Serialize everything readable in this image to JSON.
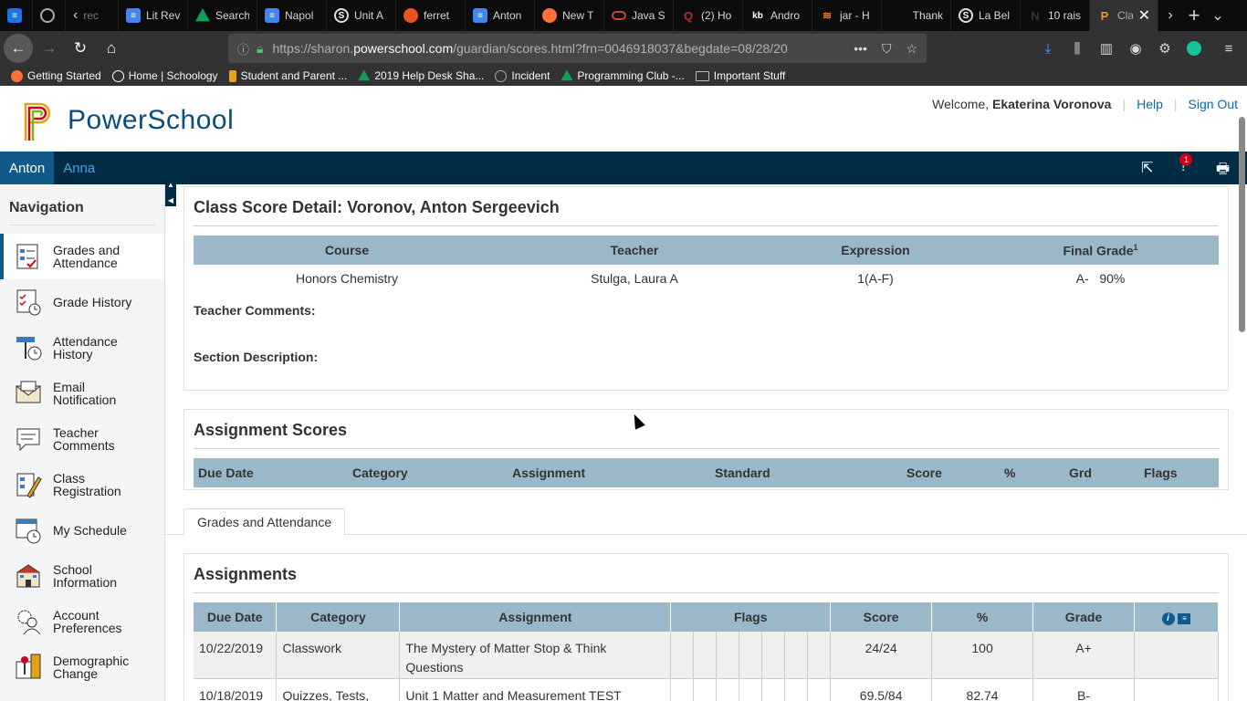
{
  "browser": {
    "tabs": [
      {
        "title": "",
        "color": "#1a73e8",
        "icon": "docs-icon"
      },
      {
        "title": "",
        "color": "#555",
        "icon": "circle-icon"
      },
      {
        "title": "rec",
        "color": "#0c0c0d",
        "icon": "chevron-left-icon"
      },
      {
        "title": "Lit Rev",
        "color": "#4285f4",
        "icon": "docs-icon"
      },
      {
        "title": "Search",
        "color": "#0f9d58",
        "icon": "drive-icon"
      },
      {
        "title": "Napol",
        "color": "#4285f4",
        "icon": "docs-icon"
      },
      {
        "title": "Unit A",
        "color": "#333",
        "icon": "schoology-icon"
      },
      {
        "title": "ferret",
        "color": "#e8541e",
        "icon": "duckduckgo-icon"
      },
      {
        "title": "Anton",
        "color": "#4285f4",
        "icon": "docs-icon"
      },
      {
        "title": "New T",
        "color": "#ff7139",
        "icon": "firefox-icon"
      },
      {
        "title": "Java S",
        "color": "#c74634",
        "icon": "oracle-icon"
      },
      {
        "title": "(2) Ho",
        "color": "#b92b27",
        "icon": "quora-icon"
      },
      {
        "title": "Andro",
        "color": "#222",
        "icon": "kb-icon"
      },
      {
        "title": "jar - H",
        "color": "#f48024",
        "icon": "stackoverflow-icon"
      },
      {
        "title": "Thank",
        "color": "#0c0c0d",
        "icon": "blank-icon"
      },
      {
        "title": "La Bel",
        "color": "#333",
        "icon": "schoology-icon"
      },
      {
        "title": "10 rais",
        "color": "#0c0c0d",
        "icon": "netflix-icon"
      },
      {
        "title": "Cla",
        "color": "#323234",
        "icon": "powerschool-icon",
        "active": true
      }
    ],
    "url_prefix": "https://sharon.",
    "url_host": "powerschool.com",
    "url_rest": "/guardian/scores.html?frn=0046918037&begdate=08/28/20",
    "bookmarks": [
      {
        "label": "Getting Started",
        "color": "#ff7139"
      },
      {
        "label": "Home | Schoology",
        "color": "#fff"
      },
      {
        "label": "Student and Parent ...",
        "color": "#e3a21a"
      },
      {
        "label": "2019 Help Desk Sha...",
        "color": "#0f9d58"
      },
      {
        "label": "Incident",
        "color": "#aaa"
      },
      {
        "label": "Programming Club -...",
        "color": "#0f9d58"
      },
      {
        "label": "Important Stuff",
        "color": "#888"
      }
    ]
  },
  "header": {
    "logo_text": "PowerSchool",
    "welcome": "Welcome,",
    "user_name": "Ekaterina Voronova",
    "help": "Help",
    "sign_out": "Sign Out",
    "alert_count": "1"
  },
  "students": [
    "Anton",
    "Anna"
  ],
  "sidebar": {
    "title": "Navigation",
    "items": [
      {
        "label1": "Grades and",
        "label2": "Attendance",
        "icon": "grades-icon"
      },
      {
        "label1": "Grade History",
        "label2": "",
        "icon": "grade-history-icon"
      },
      {
        "label1": "Attendance",
        "label2": "History",
        "icon": "attendance-history-icon"
      },
      {
        "label1": "Email",
        "label2": "Notification",
        "icon": "email-icon"
      },
      {
        "label1": "Teacher",
        "label2": "Comments",
        "icon": "comments-icon"
      },
      {
        "label1": "Class",
        "label2": "Registration",
        "icon": "registration-icon"
      },
      {
        "label1": "My Schedule",
        "label2": "",
        "icon": "schedule-icon"
      },
      {
        "label1": "School",
        "label2": "Information",
        "icon": "school-icon"
      },
      {
        "label1": "Account",
        "label2": "Preferences",
        "icon": "account-icon"
      },
      {
        "label1": "Demographic",
        "label2": "Change",
        "icon": "demographic-icon"
      }
    ]
  },
  "class_detail": {
    "title": "Class Score Detail: Voronov, Anton Sergeevich",
    "headers": {
      "course": "Course",
      "teacher": "Teacher",
      "expression": "Expression",
      "final_grade": "Final Grade",
      "footnote": "1"
    },
    "row": {
      "course": "Honors Chemistry",
      "teacher": "Stulga, Laura A",
      "expression": "1(A-F)",
      "grade": "A-",
      "percent": "90%"
    },
    "teacher_comments_label": "Teacher Comments:",
    "section_description_label": "Section Description:"
  },
  "assignment_scores": {
    "title": "Assignment Scores",
    "headers": {
      "due_date": "Due Date",
      "category": "Category",
      "assignment": "Assignment",
      "standard": "Standard",
      "score": "Score",
      "percent": "%",
      "grd": "Grd",
      "flags": "Flags"
    }
  },
  "content_tab": "Grades and Attendance",
  "assignments": {
    "title": "Assignments",
    "headers": {
      "due_date": "Due Date",
      "category": "Category",
      "assignment": "Assignment",
      "flags": "Flags",
      "score": "Score",
      "percent": "%",
      "grade": "Grade"
    },
    "rows": [
      {
        "due_date": "10/22/2019",
        "category": "Classwork",
        "assignment": "The Mystery of Matter Stop & Think Questions",
        "score": "24/24",
        "percent": "100",
        "grade": "A+"
      },
      {
        "due_date": "10/18/2019",
        "category": "Quizzes, Tests, Projects",
        "assignment": "Unit 1 Matter and Measurement TEST",
        "score": "69.5/84",
        "percent": "82.74",
        "grade": "B-"
      }
    ]
  }
}
